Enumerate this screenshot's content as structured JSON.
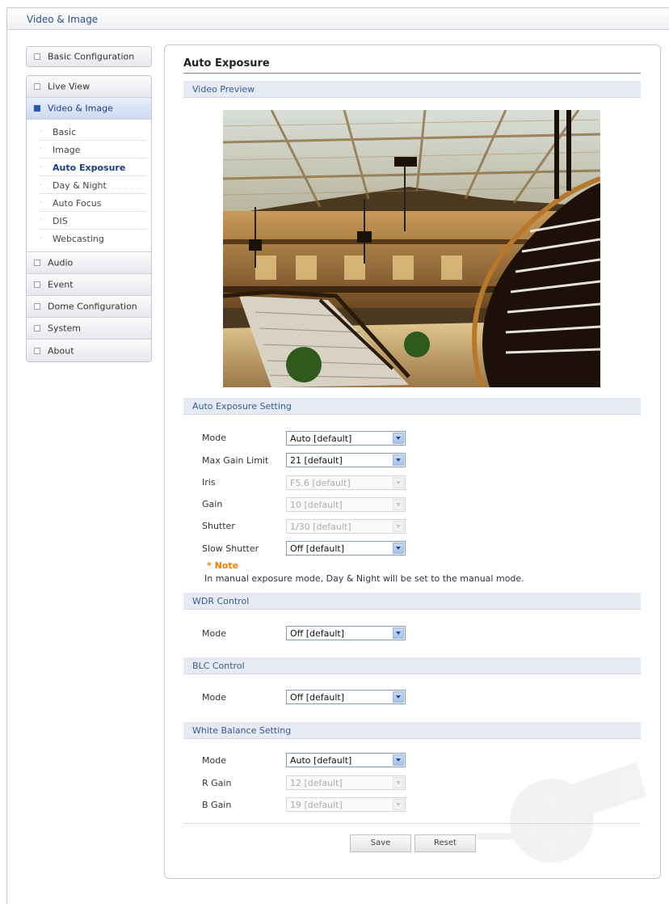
{
  "topbar": {
    "title": "Video & Image"
  },
  "sidebar": {
    "basic_configuration": "Basic Configuration",
    "live_view": "Live View",
    "video_image": "Video & Image",
    "sub_items": [
      "Basic",
      "Image",
      "Auto Exposure",
      "Day & Night",
      "Auto Focus",
      "DIS",
      "Webcasting"
    ],
    "audio": "Audio",
    "event": "Event",
    "dome_configuration": "Dome Configuration",
    "system": "System",
    "about": "About"
  },
  "page": {
    "title": "Auto Exposure"
  },
  "video_preview": {
    "header": "Video Preview"
  },
  "auto_exposure": {
    "header": "Auto Exposure Setting",
    "mode_label": "Mode",
    "mode_value": "Auto  [default]",
    "max_gain_label": "Max Gain Limit",
    "max_gain_value": "21  [default]",
    "iris_label": "Iris",
    "iris_value": "F5.6  [default]",
    "gain_label": "Gain",
    "gain_value": "10  [default]",
    "shutter_label": "Shutter",
    "shutter_value": "1/30  [default]",
    "slow_shutter_label": "Slow Shutter",
    "slow_shutter_value": "Off [default]",
    "note_title": "* Note",
    "note_text": "In manual exposure mode, Day & Night will be set to the manual mode."
  },
  "wdr": {
    "header": "WDR Control",
    "mode_label": "Mode",
    "mode_value": "Off [default]"
  },
  "blc": {
    "header": "BLC Control",
    "mode_label": "Mode",
    "mode_value": "Off [default]"
  },
  "white_balance": {
    "header": "White Balance Setting",
    "mode_label": "Mode",
    "mode_value": "Auto [default]",
    "r_gain_label": "R Gain",
    "r_gain_value": "12  [default]",
    "b_gain_label": "B Gain",
    "b_gain_value": "19  [default]"
  },
  "buttons": {
    "save": "Save",
    "reset": "Reset"
  },
  "colors": {
    "accent": "#3b5a94",
    "note": "#f08000",
    "active_menu": "#ccdaf1"
  },
  "icons": {
    "menu_collapsed": "square-icon",
    "menu_expanded": "filled-square-icon",
    "dropdown": "chevron-down-icon"
  }
}
